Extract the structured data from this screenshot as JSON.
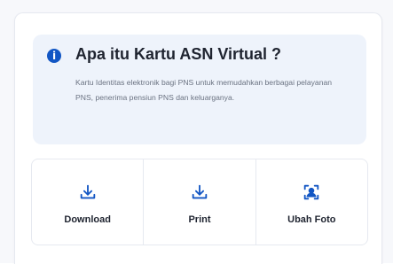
{
  "info": {
    "icon": "info-icon",
    "title": "Apa itu Kartu ASN Virtual ?",
    "description": "Kartu Identitas elektronik bagi PNS untuk memudahkan berbagai pelayanan PNS, penerima pensiun PNS dan keluarganya."
  },
  "actions": [
    {
      "label": "Download",
      "icon": "download-icon"
    },
    {
      "label": "Print",
      "icon": "print-icon"
    },
    {
      "label": "Ubah Foto",
      "icon": "profile-photo-icon"
    }
  ],
  "colors": {
    "accent": "#1256c4",
    "info_bg": "#eef3fb",
    "text": "#1f2430",
    "muted_text": "#6b7382",
    "border": "#e6e9f0"
  }
}
